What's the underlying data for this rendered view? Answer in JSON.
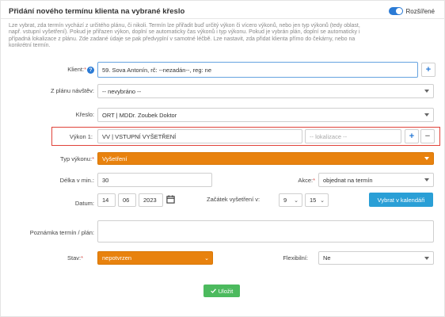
{
  "header": {
    "title": "Přidání nového termínu klienta na vybrané křeslo",
    "toggle_label": "Rozšířené"
  },
  "description": [
    "Lze vybrat, zda termín vychází z určitého plánu, či nikoli. Termín lze přiřadit buď určitý výkon či vícero výkonů, nebo jen typ výkonů (tedy oblast,",
    "např. vstupní vyšetření). Pokud je přiřazen výkon, doplní se automaticky čas výkonů i typ výkonu. Pokud je vybrán plán, doplní se automaticky i",
    "případná lokalizace z plánu. Zde zadané údaje se pak předvyplní v samotné léčbě. Lze nastavit, zda přidat klienta přímo do čekárny, nebo na",
    "konkrétní termín."
  ],
  "form": {
    "klient": {
      "label": "Klient:",
      "required_mark": "*",
      "help": "?",
      "value": "59. Sova Antonín, rč: --nezadán--, reg: ne"
    },
    "plan": {
      "label": "Z plánu návštěv:",
      "value": "-- nevybráno --"
    },
    "kreslo": {
      "label": "Křeslo:",
      "value": "ORT | MDDr. Zoubek Doktor"
    },
    "vykon": {
      "label": "Výkon 1:",
      "value": "VV | VSTUPNÍ  VYŠETŘENÍ",
      "lokalizace_placeholder": "-- lokalizace --"
    },
    "typ_vykonu": {
      "label": "Typ výkonu:",
      "required_mark": "*",
      "value": "Vyšetření"
    },
    "delka": {
      "label": "Délka v min.:",
      "value": "30"
    },
    "akce": {
      "label": "Akce:",
      "required_mark": "*",
      "value": "objednat na termín"
    },
    "datum": {
      "label": "Datum:",
      "day": "14",
      "month": "06",
      "year": "2023"
    },
    "zacatek": {
      "label": "Začátek vyšetření v:",
      "hour": "9",
      "minute": "15"
    },
    "vybrat_button": "Vybrat v kalendáři",
    "poznamka": {
      "label": "Poznámka termín / plán:"
    },
    "stav": {
      "label": "Stav:",
      "required_mark": "*",
      "value": "nepotvrzen"
    },
    "flexibilni": {
      "label": "Flexibilní:",
      "value": "Ne"
    },
    "save_button": "Uložit",
    "plus": "+",
    "minus": "−"
  },
  "colors": {
    "accent_blue": "#2a7ad5",
    "button_blue": "#2a9fd6",
    "orange": "#e8820e",
    "green": "#4cba5e",
    "highlight_red": "#e0433a"
  }
}
